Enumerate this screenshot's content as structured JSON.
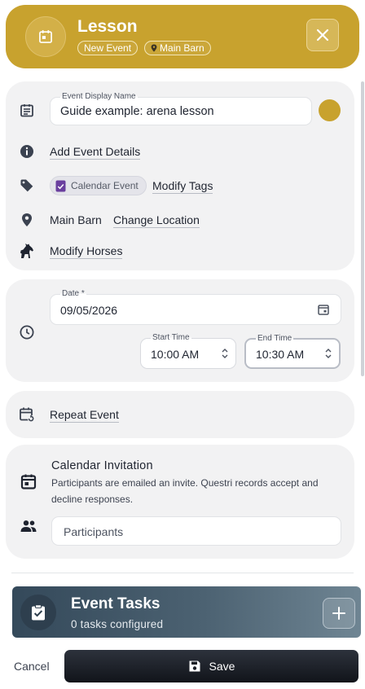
{
  "header": {
    "title": "Lesson",
    "badges": [
      "New Event",
      "Main Barn"
    ],
    "accent_color": "#c8a22e",
    "icons": {
      "event": "calendar-icon",
      "close": "close-icon",
      "location": "location-pin-icon"
    }
  },
  "details": {
    "display_name_label": "Event Display Name",
    "display_name_value": "Guide example: arena lesson",
    "event_color": "#c8a22e",
    "add_details_link": "Add Event Details",
    "tag_chip": "Calendar Event",
    "modify_tags_link": "Modify Tags",
    "location_value": "Main Barn",
    "change_location_link": "Change Location",
    "modify_horses_link": "Modify Horses"
  },
  "schedule": {
    "date_label": "Date *",
    "date_value": "09/05/2026",
    "start_label": "Start Time",
    "start_value": "10:00 AM",
    "end_label": "End Time",
    "end_value": "10:30 AM"
  },
  "repeat": {
    "link": "Repeat Event"
  },
  "invitation": {
    "title": "Calendar Invitation",
    "description": "Participants are emailed an invite. Questri records accept and decline responses.",
    "participants_placeholder": "Participants"
  },
  "tasks": {
    "title": "Event Tasks",
    "subtitle": "0 tasks configured"
  },
  "footer": {
    "cancel_label": "Cancel",
    "save_label": "Save"
  }
}
